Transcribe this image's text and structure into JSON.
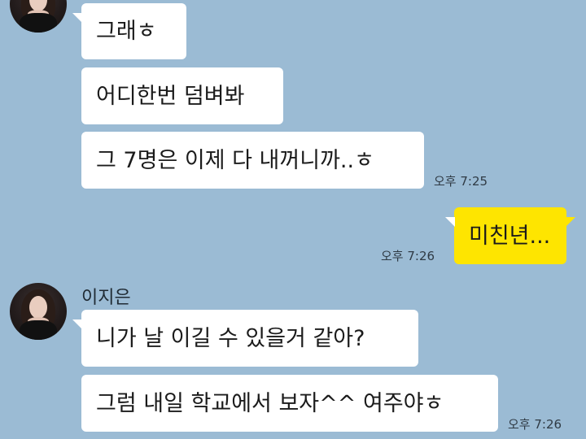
{
  "chat": {
    "messages": [
      {
        "sender": "other",
        "text": "그래ㅎ"
      },
      {
        "sender": "other",
        "text": "어디한번 덤벼봐"
      },
      {
        "sender": "other",
        "text": "그 7명은 이제 다 내꺼니까..ㅎ",
        "time": "오후 7:25"
      },
      {
        "sender": "me",
        "text": "미친년...",
        "time": "오후 7:26"
      },
      {
        "sender": "other",
        "name": "이지은",
        "text": "니가 날 이길 수 있을거 같아?"
      },
      {
        "sender": "other",
        "text": "그럼 내일 학교에서 보자^^ 여주야ㅎ",
        "time": "오후 7:26"
      }
    ]
  },
  "colors": {
    "background": "#9bbbd4",
    "other_bubble": "#ffffff",
    "my_bubble": "#fee500"
  },
  "icons": {
    "avatar": "profile-photo"
  }
}
